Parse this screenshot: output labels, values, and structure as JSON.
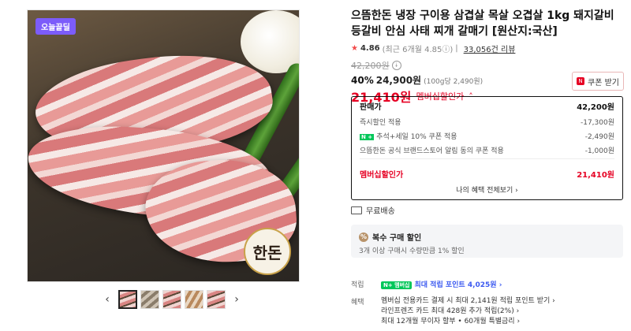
{
  "gallery": {
    "badge": "오늘끝딜",
    "seal_text": "한돈",
    "prev_arrow": "‹",
    "next_arrow": "›",
    "thumbnail_count": 5
  },
  "product": {
    "title": "으뜸한돈 냉장 구이용 삼겹살 목살 오겹살 1kg 돼지갈비 등갈비 안심 사태 찌개 갈매기 [원산지:국산]",
    "rating": "4.86",
    "rating_sub": "(최근 6개월 4.85ⓘ)",
    "reviews": "33,056건 리뷰",
    "original_price": "42,200원",
    "discount_pct": "40%",
    "sale_price": "24,900원",
    "unit_price": "(100g당 2,490원)",
    "member_price": "21,410원",
    "member_label": "멤버십할인가",
    "coupon_button": "쿠폰 받기"
  },
  "breakdown": {
    "rows": [
      {
        "label": "판매가",
        "value": "42,200원"
      },
      {
        "label": "즉시할인 적용",
        "value": "-17,300원"
      },
      {
        "label": "추석+세일 10% 쿠폰 적용",
        "value": "-2,490원"
      },
      {
        "label": "으뜸한돈 공식 브랜드스토어 알림 동의 쿠폰 적용",
        "value": "-1,000원"
      }
    ],
    "n_badge": "N +",
    "member": {
      "label": "멤버십할인가",
      "value": "21,410원"
    },
    "more_link": "나의 혜택 전체보기 ›"
  },
  "shipping": {
    "label": "무료배송"
  },
  "multi": {
    "title": "복수 구매 할인",
    "desc": "3개 이상 구매시 수량만큼 1% 할인"
  },
  "points": {
    "label": "적립",
    "badge": "N+ 멤버십",
    "text": "최대 적립 포인트 4,025원 ›"
  },
  "benefits": {
    "label": "혜택",
    "items": [
      "멤버십 전용카드 결제 시 최대 2,141원 적립 포인트 받기 ›",
      "라인프렌즈 카드 최대 428원 추가 적립(2%) ›",
      "최대 12개월 무이자 할부 • 60개월 특별금리 ›"
    ]
  },
  "colors": {
    "accent_red": "#e60023",
    "naver_green": "#03c75a",
    "points_blue": "#3c5af0"
  }
}
